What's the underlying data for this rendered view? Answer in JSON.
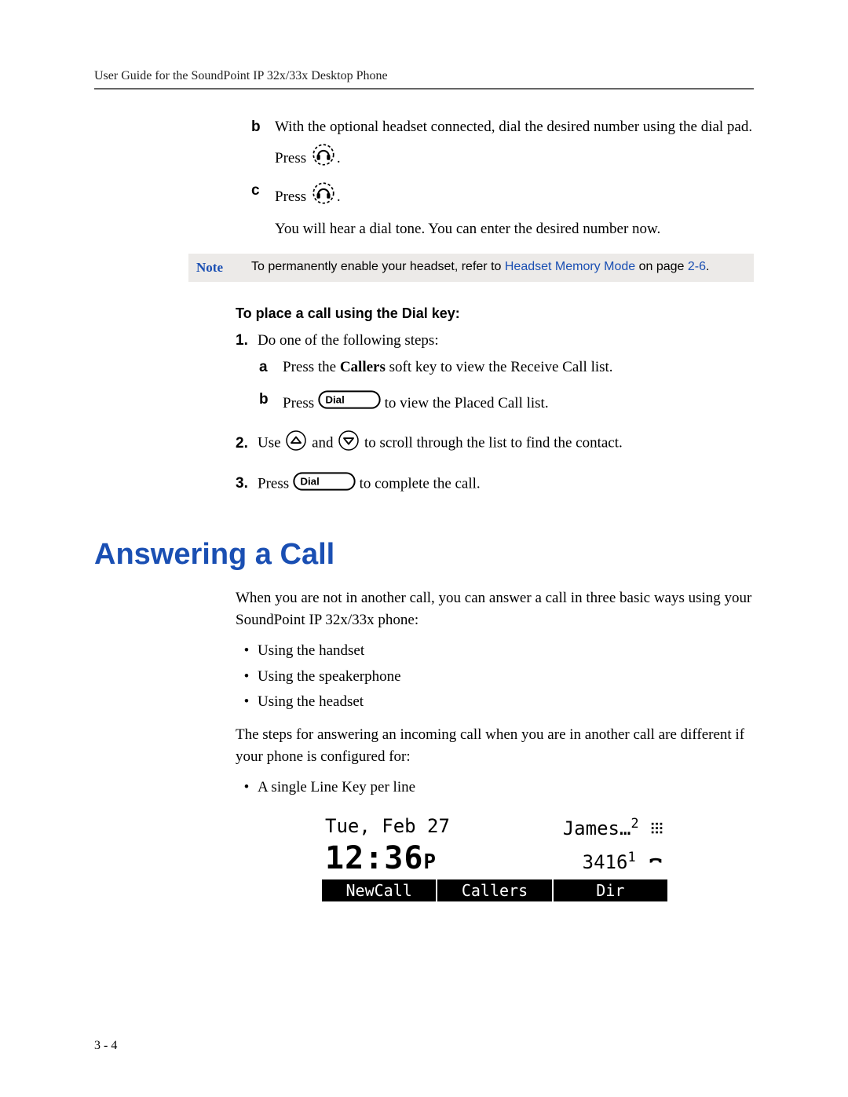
{
  "header": {
    "title": "User Guide for the SoundPoint IP 32x/33x Desktop Phone"
  },
  "section1": {
    "steps": {
      "b": {
        "marker": "b",
        "text": "With the optional headset connected, dial the desired number using the dial pad.",
        "press": "Press",
        "period": "."
      },
      "c": {
        "marker": "c",
        "press": "Press",
        "period": ".",
        "followup": "You will hear a dial tone. You can enter the desired number now."
      }
    }
  },
  "note": {
    "label": "Note",
    "text_before": "To permanently enable your headset, refer to ",
    "link": "Headset Memory Mode",
    "text_after": " on page ",
    "page_ref": "2-6",
    "tail": "."
  },
  "dial_key": {
    "heading": "To place a call using the Dial key:",
    "steps": {
      "1": {
        "num": "1.",
        "text": "Do one of the following steps:"
      },
      "1a": {
        "marker": "a",
        "text_before": "Press the ",
        "bold": "Callers",
        "text_after": " soft key to view the Receive Call list."
      },
      "1b": {
        "marker": "b",
        "press": "Press",
        "after": " to view the Placed Call list."
      },
      "2": {
        "num": "2.",
        "before": "Use ",
        "mid": " and ",
        "after": " to scroll through the list to find the contact."
      },
      "3": {
        "num": "3.",
        "press": "Press ",
        "after": " to complete the call."
      }
    },
    "key_label": "Dial"
  },
  "answering": {
    "heading": "Answering a Call",
    "intro": "When you are not in another call, you can answer a call in three basic ways using your SoundPoint IP 32x/33x phone:",
    "bullets": [
      "Using the handset",
      "Using the speakerphone",
      "Using the headset"
    ],
    "para2": "The steps for answering an incoming call when you are in another call are different if your phone is configured for:",
    "bullets2": [
      "A single Line Key per line"
    ]
  },
  "lcd": {
    "date": "Tue, Feb 27",
    "name": "James…",
    "name_badge": "2",
    "time": "12:36",
    "ampm": "P",
    "ext": "3416",
    "ext_badge": "1",
    "softkeys": [
      "NewCall",
      "Callers",
      "Dir"
    ]
  },
  "footer": {
    "page": "3 - 4"
  },
  "icons": {
    "headset": "headset-icon",
    "dial_key": "dial-key-icon",
    "arrow_up": "arrow-up-icon",
    "arrow_down": "arrow-down-icon",
    "keypad": "keypad-icon",
    "phone": "phone-icon"
  }
}
